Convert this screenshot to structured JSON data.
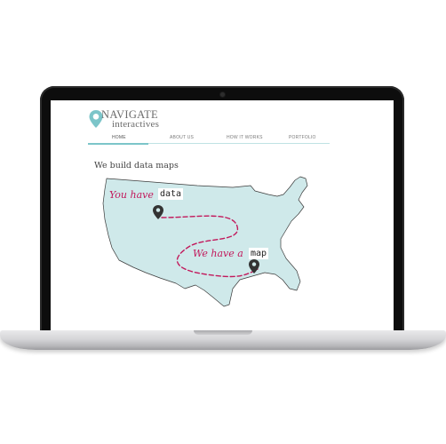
{
  "site": {
    "logo_title": "NAVIGATE",
    "logo_subtitle": "interactives"
  },
  "nav": {
    "items": [
      {
        "label": "HOME",
        "active": true
      },
      {
        "label": "ABOUT US",
        "active": false
      },
      {
        "label": "HOW IT WORKS",
        "active": false
      },
      {
        "label": "PORTFOLIO",
        "active": false
      }
    ]
  },
  "main": {
    "heading": "We build data maps"
  },
  "map": {
    "you_have": "You have",
    "data": "data",
    "we_have_a": "We have a",
    "map": "map"
  },
  "colors": {
    "accent": "#7cc5c9",
    "map_fill": "#cfe9ea",
    "path": "#c2185b",
    "handwriting": "#c2185b"
  },
  "icons": [
    "location-pin-icon",
    "map-marker-icon"
  ]
}
